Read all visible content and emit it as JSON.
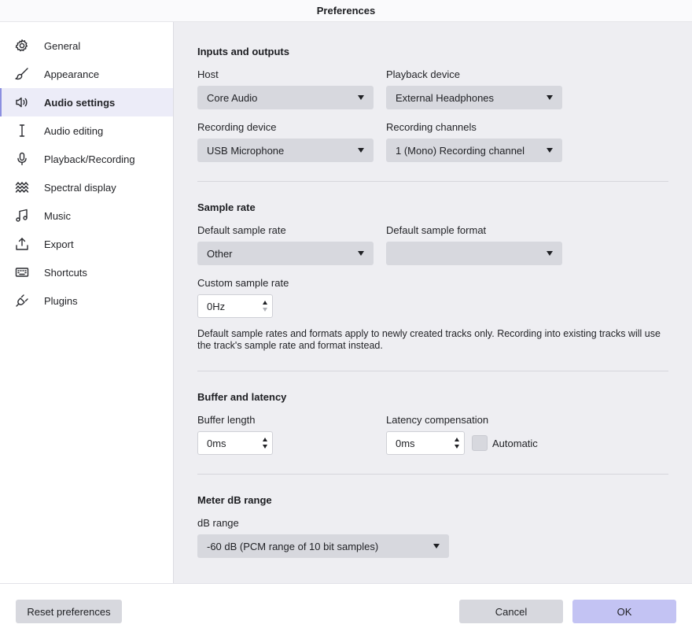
{
  "window": {
    "title": "Preferences"
  },
  "sidebar": {
    "items": [
      {
        "label": "General",
        "icon": "gear-icon",
        "active": false
      },
      {
        "label": "Appearance",
        "icon": "brush-icon",
        "active": false
      },
      {
        "label": "Audio settings",
        "icon": "speaker-icon",
        "active": true
      },
      {
        "label": "Audio editing",
        "icon": "text-cursor-icon",
        "active": false
      },
      {
        "label": "Playback/Recording",
        "icon": "microphone-icon",
        "active": false
      },
      {
        "label": "Spectral display",
        "icon": "waves-icon",
        "active": false
      },
      {
        "label": "Music",
        "icon": "music-note-icon",
        "active": false
      },
      {
        "label": "Export",
        "icon": "upload-icon",
        "active": false
      },
      {
        "label": "Shortcuts",
        "icon": "keyboard-icon",
        "active": false
      },
      {
        "label": "Plugins",
        "icon": "plug-icon",
        "active": false
      }
    ]
  },
  "inputs_outputs": {
    "title": "Inputs and outputs",
    "host": {
      "label": "Host",
      "value": "Core Audio"
    },
    "playback_device": {
      "label": "Playback device",
      "value": "External Headphones"
    },
    "recording_device": {
      "label": "Recording device",
      "value": "USB Microphone"
    },
    "recording_channels": {
      "label": "Recording channels",
      "value": "1 (Mono) Recording channel"
    }
  },
  "sample_rate": {
    "title": "Sample rate",
    "default_rate": {
      "label": "Default sample rate",
      "value": "Other"
    },
    "default_format": {
      "label": "Default sample format",
      "value": ""
    },
    "custom_rate": {
      "label": "Custom sample rate",
      "value": "0Hz"
    },
    "note": "Default sample rates and formats apply to newly created tracks only. Recording into existing tracks will use the track's sample rate and format instead."
  },
  "buffer": {
    "title": "Buffer and latency",
    "buffer_length": {
      "label": "Buffer length",
      "value": "0ms"
    },
    "latency": {
      "label": "Latency compensation",
      "value": "0ms"
    },
    "automatic": {
      "label": "Automatic",
      "checked": false
    }
  },
  "meter": {
    "title": "Meter dB range",
    "db_range": {
      "label": "dB range",
      "value": "-60 dB (PCM range of 10 bit samples)"
    }
  },
  "footer": {
    "reset_label": "Reset preferences",
    "cancel_label": "Cancel",
    "ok_label": "OK"
  },
  "colors": {
    "accent": "#8b8fe0",
    "primary_button": "#c3c3f3",
    "content_bg": "#eeeef2",
    "control_bg": "#d7d8de"
  }
}
